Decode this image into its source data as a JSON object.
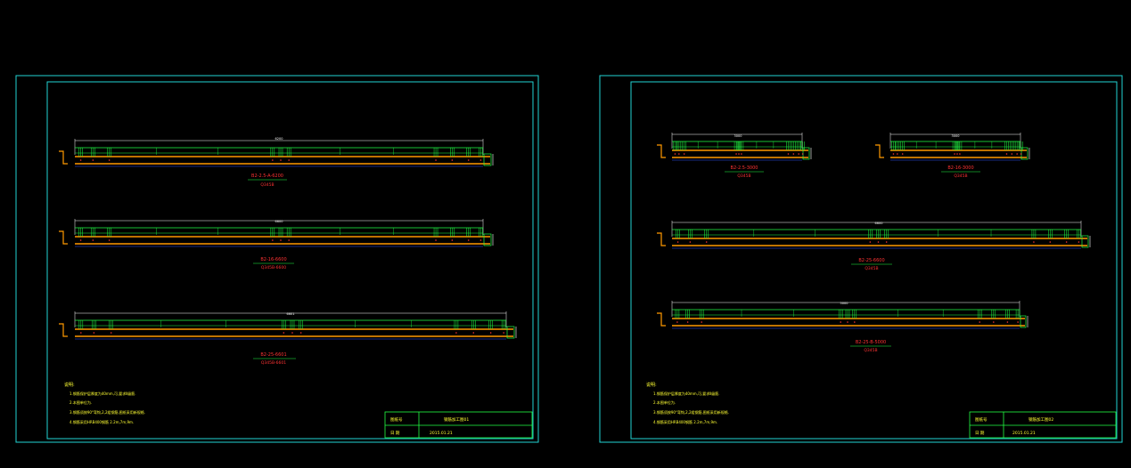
{
  "colors": {
    "background": "#000000",
    "frame": "#22d3d3",
    "green": "#22ff44",
    "orange": "#ff9900",
    "yellow": "#ffff33",
    "red": "#ff3333",
    "magenta": "#ff44ff",
    "white": "#ffffff",
    "blue": "#3355ff"
  },
  "sheets": [
    {
      "key": "left",
      "beams": [
        {
          "code": "B2-2.5-A-6200",
          "sub": "Q345B",
          "dim_label": "6200"
        },
        {
          "code": "B2-16-6600",
          "sub": "Q345B-6600",
          "dim_label": "6600"
        },
        {
          "code": "B2-25-6601",
          "sub": "Q345B-6601",
          "dim_label": "6601"
        }
      ],
      "notes": {
        "heading": "说明:",
        "items": [
          "1.钢筋保护层厚度为40mm,可,要求Ⅱ级筋.",
          "2.本图单位为.",
          "3.钢筋须按90°弯钩,2,2组钢筋,图纸采用新规格.",
          "4.钢筋采用HRB400钢筋 2.2m,7m,9m."
        ]
      },
      "title_block": {
        "label_a": "图纸号",
        "value_a": "钢筋加工图01",
        "label_b": "日 期",
        "value_b": "2015.01.21"
      }
    },
    {
      "key": "right",
      "beams": [
        {
          "code": "B2-2.5-3000",
          "sub": "Q345B",
          "dim_label": "3000"
        },
        {
          "code": "B2-16-3000",
          "sub": "Q345B",
          "dim_label": "3000"
        },
        {
          "code": "B2-25-6600",
          "sub": "Q345B",
          "dim_label": "6600"
        },
        {
          "code": "B2-25-B-5000",
          "sub": "Q345B",
          "dim_label": "5000"
        }
      ],
      "notes": {
        "heading": "说明:",
        "items": [
          "1.钢筋保护层厚度为40mm,可,要求Ⅱ级筋.",
          "2.本图单位为.",
          "3.钢筋须按90°弯钩,2,2组钢筋,图纸采用新规格.",
          "4.钢筋采用HRB400钢筋 2.2m,7m,9m."
        ]
      },
      "title_block": {
        "label_a": "图纸号",
        "value_a": "钢筋加工图02",
        "label_b": "日 期",
        "value_b": "2015.01.21"
      }
    }
  ]
}
